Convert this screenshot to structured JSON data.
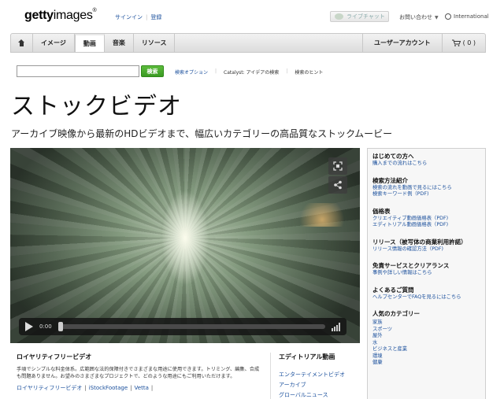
{
  "header": {
    "logo_bold": "getty",
    "logo_rest": "images",
    "logo_mark": "®",
    "signin": "サインイン",
    "separator": "|",
    "register": "登録",
    "live_chat": "ライブチャット",
    "contact": "お問い合わせ",
    "language": "International"
  },
  "nav": {
    "tabs": [
      {
        "label": "イメージ"
      },
      {
        "label": "動画"
      },
      {
        "label": "音楽"
      },
      {
        "label": "リソース"
      }
    ],
    "account": "ユーザーアカウント",
    "cart_count": "( 0 )"
  },
  "search": {
    "value": "",
    "button": "検索",
    "links": [
      "検索オプション",
      "Catalyst: アイデアの検索",
      "検索のヒント"
    ]
  },
  "page": {
    "title": "ストックビデオ",
    "subtitle": "アーカイブ映像から最新のHDビデオまで、幅広いカテゴリーの高品質なストックムービー"
  },
  "player": {
    "time": "0:00",
    "progress": 0
  },
  "royalty_free": {
    "title": "ロイヤリティフリービデオ",
    "description": "手頃でシンプルな料金体系。広範囲な法的保障付きでさまざまな用途に使用できます。トリミング、編集、合成も問題ありません。お望みのさまざまなプロジェクトで、どのような用途にもご利用いただけます。",
    "links": [
      "ロイヤリティフリービデオ",
      "iStockFootage",
      "Vetta"
    ],
    "link_sep": "|"
  },
  "editorial": {
    "title": "エディトリアル動画",
    "items": [
      "エンターテイメントビデオ",
      "アーカイブ",
      "グローバルニュース"
    ]
  },
  "sidebar": {
    "sections": [
      {
        "title": "はじめての方へ",
        "links": [
          "購入までの流れはこちら"
        ]
      },
      {
        "title": "検索方法紹介",
        "links": [
          "検索の流れを動画で見るにはこちら",
          "検索キーワード例（PDF)"
        ]
      },
      {
        "title": "価格表",
        "links": [
          "クリエイティブ動画価格表（PDF)",
          "エディトリアル動画価格表（PDF)"
        ]
      },
      {
        "title": "リリース（被写体の商業利用許諾）",
        "links": [
          "リリース情報の確認方法（PDF)"
        ]
      },
      {
        "title": "免責サービスとクリアランス",
        "links": [
          "事例や詳しい情報はこちら"
        ]
      },
      {
        "title": "よくあるご質問",
        "links": [
          "ヘルプセンターでFAQを見るにはこちら"
        ]
      }
    ],
    "categories_title": "人気のカテゴリー",
    "categories": [
      "家族",
      "スポーツ",
      "屋外",
      "水",
      "ビジネスと産業",
      "環境",
      "健康"
    ]
  }
}
